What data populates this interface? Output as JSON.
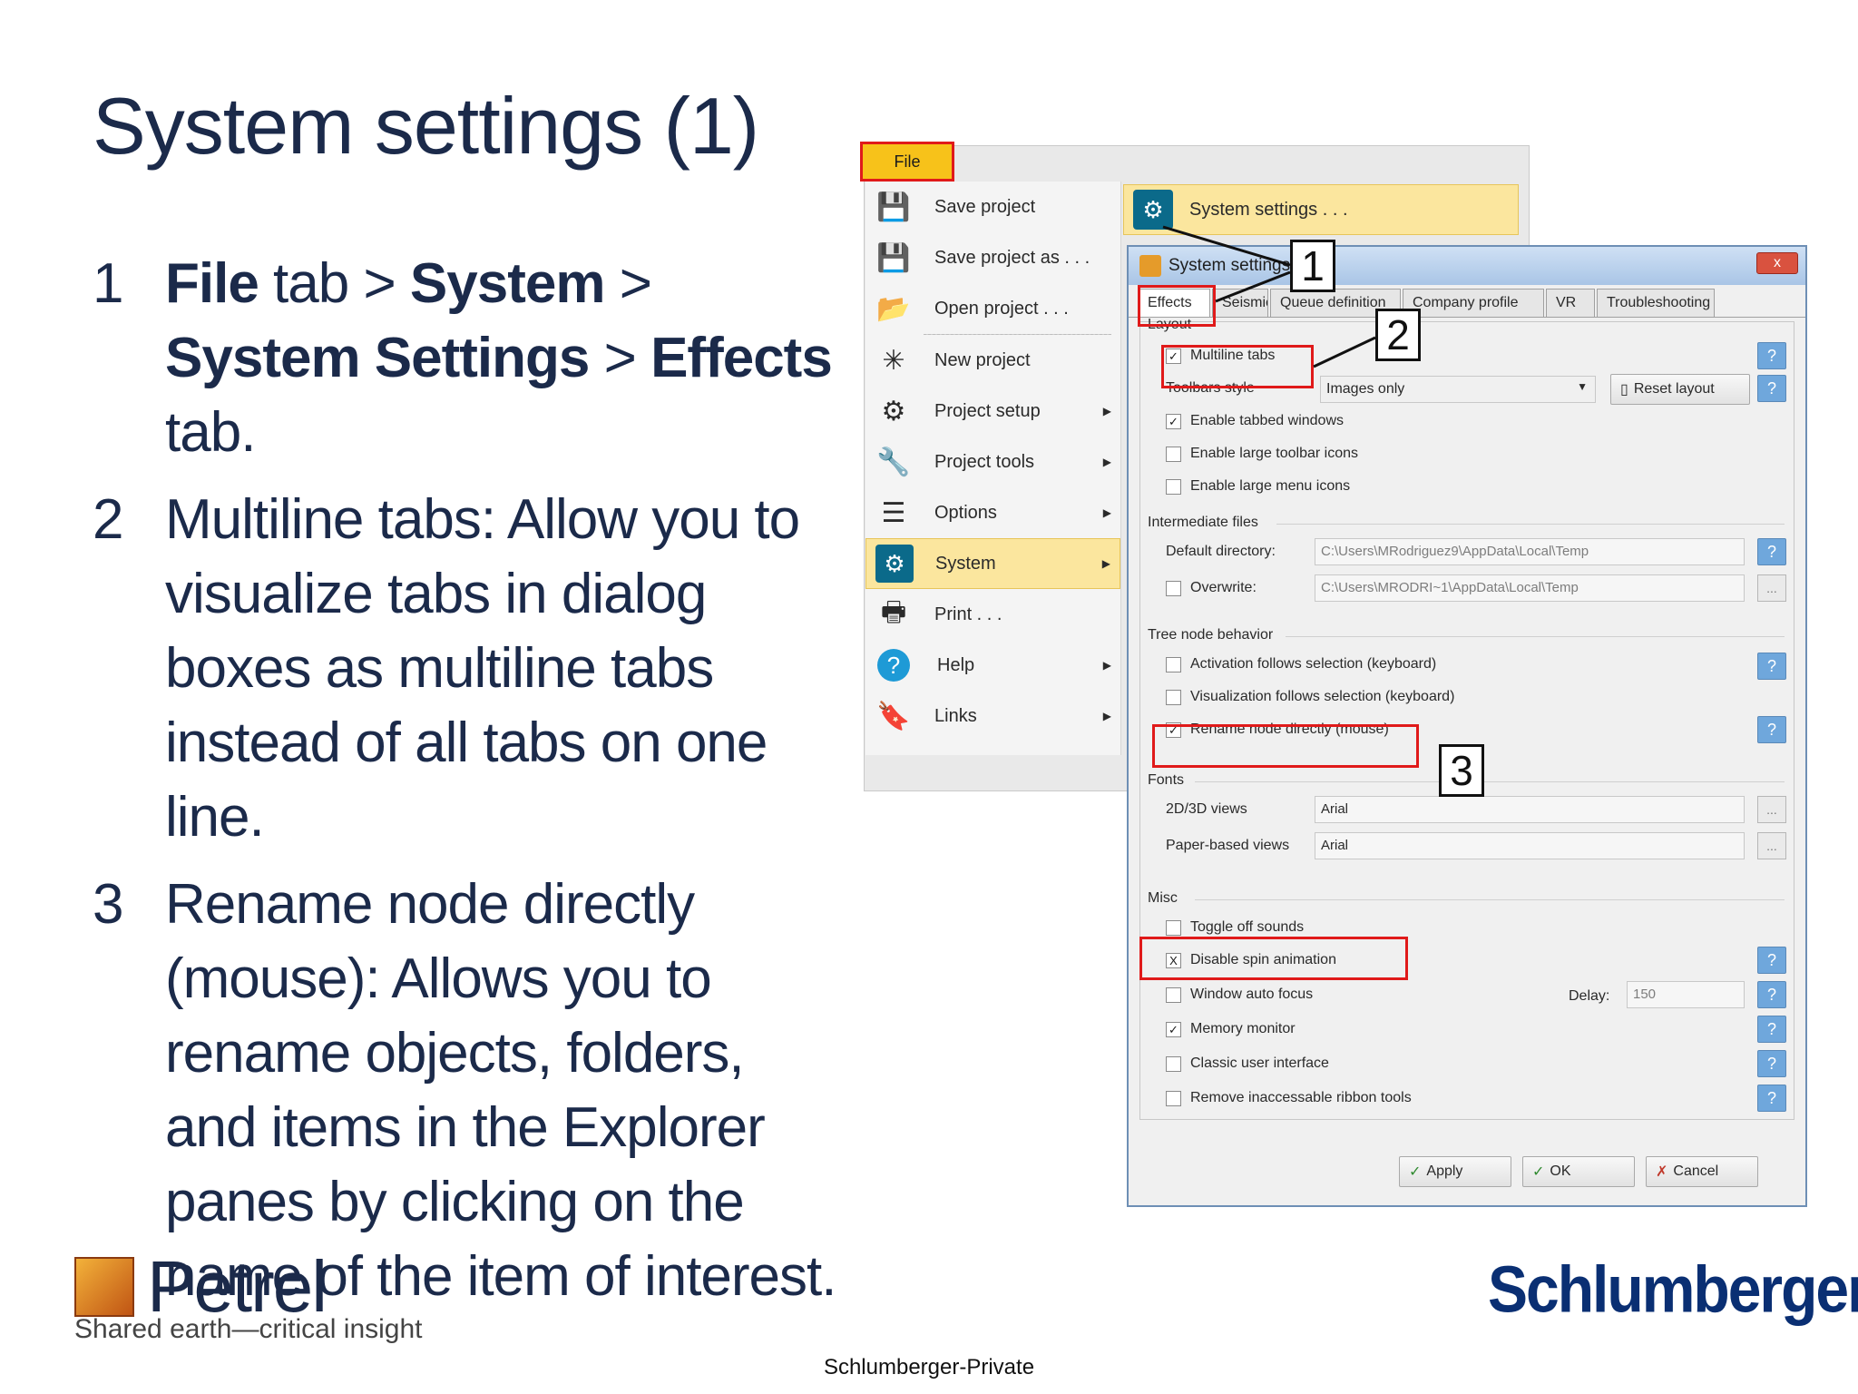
{
  "slide": {
    "title": "System settings (1)",
    "bullets": [
      {
        "num": "1",
        "parts": [
          {
            "b": true,
            "t": "File"
          },
          {
            "b": false,
            "t": " tab > "
          },
          {
            "b": true,
            "t": "System"
          },
          {
            "b": false,
            "t": " > "
          },
          {
            "b": true,
            "t": "System Settings"
          },
          {
            "b": false,
            "t": " > "
          },
          {
            "b": true,
            "t": "Effects"
          },
          {
            "b": false,
            "t": " tab."
          }
        ]
      },
      {
        "num": "2",
        "parts": [
          {
            "b": false,
            "t": "Multiline tabs: Allow you to visualize tabs in dialog boxes as multiline tabs instead of all tabs on one line."
          }
        ]
      },
      {
        "num": "3",
        "parts": [
          {
            "b": false,
            "t": "Rename node directly (mouse): Allows you to rename objects, folders, and items in the Explorer panes by clicking on the name of the item of interest."
          }
        ]
      }
    ]
  },
  "file_menu": {
    "tab_label": "File",
    "items": [
      {
        "label": "Save project",
        "icon": "save-icon",
        "glyph": "💾",
        "arrow": false
      },
      {
        "label": "Save project as . . .",
        "icon": "save-as-icon",
        "glyph": "💾",
        "arrow": false
      },
      {
        "label": "Open project . . .",
        "icon": "folder-icon",
        "glyph": "📂",
        "arrow": false
      },
      {
        "label": "New project",
        "icon": "new-project-icon",
        "glyph": "✳",
        "arrow": false
      },
      {
        "label": "Project setup",
        "icon": "gear-icon",
        "glyph": "⚙",
        "arrow": true
      },
      {
        "label": "Project tools",
        "icon": "wrench-icon",
        "glyph": "🔧",
        "arrow": true
      },
      {
        "label": "Options",
        "icon": "sliders-icon",
        "glyph": "☰",
        "arrow": true
      },
      {
        "label": "System",
        "icon": "system-icon",
        "glyph": "⚙",
        "arrow": true,
        "selected": true
      },
      {
        "label": "Print . . .",
        "icon": "printer-icon",
        "glyph": "🖶",
        "arrow": false
      },
      {
        "label": "Help",
        "icon": "help-icon",
        "glyph": "?",
        "arrow": true
      },
      {
        "label": "Links",
        "icon": "bookmark-icon",
        "glyph": "🔖",
        "arrow": true
      }
    ],
    "submenu_label": "System settings . . ."
  },
  "dialog": {
    "title": "System settings",
    "tabs": [
      "Effects",
      "Seismic",
      "Queue definition",
      "Company profile",
      "VR",
      "Troubleshooting"
    ],
    "layout": {
      "label": "Layout",
      "multiline_tabs": "Multiline tabs",
      "toolbars_style_label": "Toolbars style",
      "toolbars_style_value": "Images only",
      "reset_layout": "Reset layout",
      "enable_tabbed": "Enable tabbed windows",
      "enable_large_toolbar": "Enable large toolbar icons",
      "enable_large_menu": "Enable large menu icons"
    },
    "intermediate": {
      "label": "Intermediate files",
      "default_dir_label": "Default directory:",
      "default_dir_value": "C:\\Users\\MRodriguez9\\AppData\\Local\\Temp",
      "overwrite_label": "Overwrite:",
      "overwrite_value": "C:\\Users\\MRODRI~1\\AppData\\Local\\Temp"
    },
    "tree": {
      "label": "Tree node behavior",
      "activation": "Activation follows selection (keyboard)",
      "visualization": "Visualization follows selection (keyboard)",
      "rename": "Rename node directly (mouse)"
    },
    "fonts": {
      "label": "Fonts",
      "views_2d3d_label": "2D/3D views",
      "views_2d3d_value": "Arial",
      "paper_label": "Paper-based views",
      "paper_value": "Arial"
    },
    "misc": {
      "label": "Misc",
      "toggle_sounds": "Toggle off sounds",
      "disable_spin": "Disable spin animation",
      "window_focus": "Window auto focus",
      "delay_label": "Delay:",
      "delay_value": "150",
      "memory_monitor": "Memory monitor",
      "classic_ui": "Classic user interface",
      "remove_ribbon": "Remove inaccessable ribbon tools"
    },
    "buttons": {
      "apply": "Apply",
      "ok": "OK",
      "cancel": "Cancel"
    },
    "close_glyph": "x"
  },
  "callouts": [
    "1",
    "2",
    "3"
  ],
  "branding": {
    "petrel": "Petrel",
    "tagline": "Shared earth—critical insight",
    "schlumberger": "Schlumberger",
    "footer": "Schlumberger-Private"
  },
  "colors": {
    "highlight_red": "#e01a1a",
    "menu_yellow": "#f7c21a",
    "title_navy": "#1b2a4a",
    "brand_blue": "#0a2f73"
  }
}
